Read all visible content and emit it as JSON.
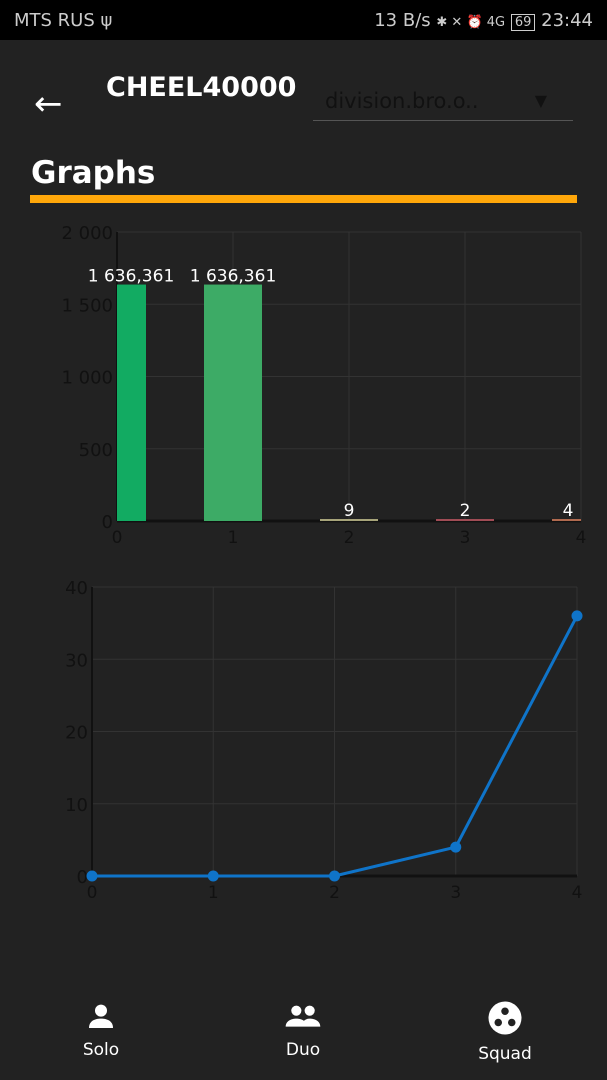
{
  "status_bar": {
    "carrier": "MTS RUS",
    "usb": "ψ",
    "speed": "13 B/s",
    "icons": "✱ ✕ ⏰ 4G",
    "battery": "69",
    "time": "23:44"
  },
  "header": {
    "back_icon": "←",
    "title": "CHEEL40000",
    "dropdown_value": "division.bro.o..",
    "dropdown_arrow": "▼"
  },
  "section_title": "Graphs",
  "chart_data": [
    {
      "type": "bar",
      "categories": [
        "0",
        "1",
        "2",
        "3",
        "4"
      ],
      "values": [
        1636.361,
        1636.361,
        9,
        2,
        4
      ],
      "labels": [
        "1 636,361",
        "1 636,361",
        "9",
        "2",
        "4"
      ],
      "colors": [
        "#12ab62",
        "#3dab66",
        "#a7a47a",
        "#a04c55",
        "#b06a4f"
      ],
      "yticks": [
        "0",
        "500",
        "1 000",
        "1 500",
        "2 000"
      ],
      "ytick_values": [
        0,
        500,
        1000,
        1500,
        2000
      ],
      "ylim": [
        0,
        2000
      ],
      "grid": true
    },
    {
      "type": "line",
      "x": [
        0,
        1,
        2,
        3,
        4
      ],
      "y": [
        0,
        0,
        0,
        4,
        36
      ],
      "color": "#0f74c9",
      "xticks": [
        "0",
        "1",
        "2",
        "3",
        "4"
      ],
      "yticks": [
        "0",
        "10",
        "20",
        "30",
        "40"
      ],
      "ytick_values": [
        0,
        10,
        20,
        30,
        40
      ],
      "ylim": [
        0,
        40
      ],
      "grid": true
    }
  ],
  "bottom_nav": [
    {
      "label": "Solo",
      "icon": "person-icon"
    },
    {
      "label": "Duo",
      "icon": "people-icon"
    },
    {
      "label": "Squad",
      "icon": "squad-icon"
    }
  ]
}
